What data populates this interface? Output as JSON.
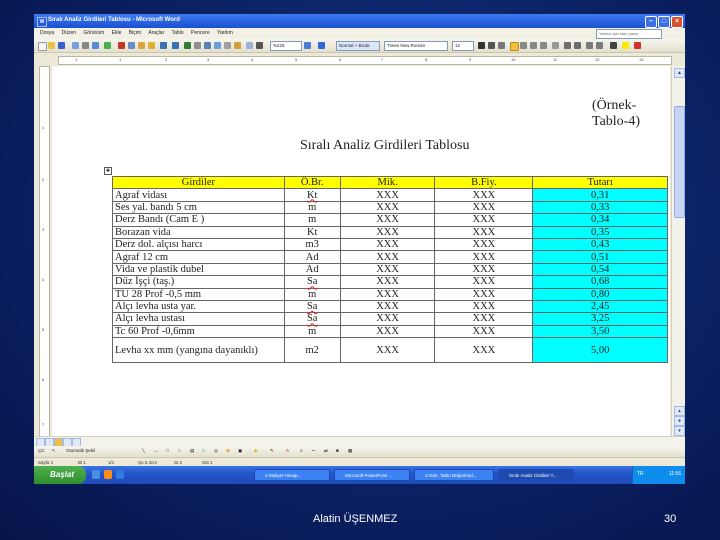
{
  "window": {
    "title": "Sıralı Analiz Girdileri Tablosu - Microsoft Word"
  },
  "menu": {
    "items": [
      "Dosya",
      "Düzen",
      "Görünüm",
      "Ekle",
      "Biçim",
      "Araçlar",
      "Tablo",
      "Pencere",
      "Yardım"
    ],
    "help_placeholder": "Yardım için soru yazın"
  },
  "formatting": {
    "zoom": "%225",
    "style": "Normal + Bicak",
    "font": "Times New Roman",
    "size": "12"
  },
  "document": {
    "caption": "(Örnek-Tablo-4)",
    "title": "Sıralı Analiz Girdileri Tablosu",
    "table": {
      "headers": [
        "Girdiler",
        "Ö.Br.",
        "Mik.",
        "B.Fiy.",
        "Tutarı"
      ],
      "rows": [
        [
          "Agraf vidası",
          "Kt",
          "XXX",
          "XXX",
          "0,31"
        ],
        [
          "Ses yal. bandı 5 cm",
          "m",
          "XXX",
          "XXX",
          "0,33"
        ],
        [
          "Derz Bandı (Cam E )",
          "m",
          "XXX",
          "XXX",
          "0,34"
        ],
        [
          "Borazan vida",
          "Kt",
          "XXX",
          "XXX",
          "0,35"
        ],
        [
          "Derz dol. alçısı harcı",
          "m3",
          "XXX",
          "XXX",
          "0,43"
        ],
        [
          "Agraf 12 cm",
          "Ad",
          "XXX",
          "XXX",
          "0,51"
        ],
        [
          "Vida ve plastik dubel",
          "Ad",
          "XXX",
          "XXX",
          "0,54"
        ],
        [
          "Düz İşçi (taş.)",
          "Sa",
          "XXX",
          "XXX",
          "0,68"
        ],
        [
          "TU 28 Prof -0,5 mm",
          "m",
          "XXX",
          "XXX",
          "0,80"
        ],
        [
          "Alçı levha usta yar.",
          "Sa",
          "XXX",
          "XXX",
          "2,45"
        ],
        [
          "Alçı levha ustası",
          "Sa",
          "XXX",
          "XXX",
          "3,25"
        ],
        [
          "Tc 60 Prof -0,6mm",
          "m",
          "XXX",
          "XXX",
          "3,50"
        ],
        [
          "Levha xx mm (yangına dayanıklı)",
          "m2",
          "XXX",
          "XXX",
          "5,00"
        ]
      ]
    }
  },
  "drawing_toolbar": {
    "draw_label": "Çiz",
    "autoshapes_label": "Otomatik Şekil"
  },
  "status_bar": {
    "page": "Sayfa 1",
    "section": "Bl 1",
    "pages": "1/1",
    "position": "Şu 2,4cm",
    "line": "St 2",
    "column": "Süt 1"
  },
  "taskbar": {
    "start_label": "Başlat",
    "tasks": [
      "2-Maliyet Hesap...",
      "Microsoft PowerPoint ...",
      "3-Gün. Tablo Değerlend...",
      "Sıralı Analiz Girdileri T..."
    ],
    "tray_label": "TR",
    "clock": "11:56"
  },
  "slide_footer": {
    "author": "Alatin ÜŞENMEZ",
    "page_number": "30"
  },
  "colors": {
    "header_fill": "#ffff00",
    "total_fill": "#00ffff",
    "desktop": "#0c2266"
  }
}
